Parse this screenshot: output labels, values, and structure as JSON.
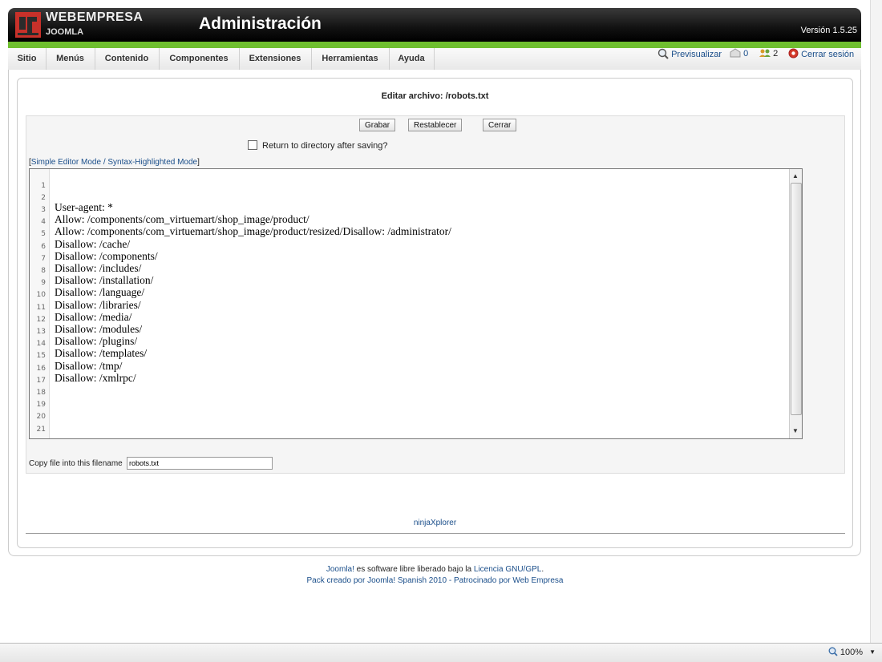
{
  "header": {
    "brand": "WEBEMPRESA",
    "brand_sub": "JOOMLA",
    "title": "Administración",
    "version": "Versión 1.5.25"
  },
  "menu": {
    "items": [
      "Sitio",
      "Menús",
      "Contenido",
      "Componentes",
      "Extensiones",
      "Herramientas",
      "Ayuda"
    ]
  },
  "status": {
    "preview": "Previsualizar",
    "messages_count": "0",
    "users_count": "2",
    "logout": "Cerrar sesión"
  },
  "editor": {
    "title": "Editar archivo: /robots.txt",
    "buttons": {
      "save": "Grabar",
      "reset": "Restablecer",
      "close": "Cerrar"
    },
    "return_label": "Return to directory after saving?",
    "mode_open": "[",
    "mode_simple": "Simple Editor Mode",
    "mode_sep": " / ",
    "mode_syntax": "Syntax-Highlighted Mode",
    "mode_close": "]",
    "line_numbers": [
      "1",
      "2",
      "3",
      "4",
      "5",
      "6",
      "7",
      "8",
      "9",
      "10",
      "11",
      "12",
      "13",
      "14",
      "15",
      "16",
      "17",
      "18",
      "19",
      "20",
      "21"
    ],
    "lines": [
      "",
      "",
      "User-agent: *",
      "Allow: /components/com_virtuemart/shop_image/product/",
      "Allow: /components/com_virtuemart/shop_image/product/resized/Disallow: /administrator/",
      "Disallow: /cache/",
      "Disallow: /components/",
      "Disallow: /includes/",
      "Disallow: /installation/",
      "Disallow: /language/",
      "Disallow: /libraries/",
      "Disallow: /media/",
      "Disallow: /modules/",
      "Disallow: /plugins/",
      "Disallow: /templates/",
      "Disallow: /tmp/",
      "Disallow: /xmlrpc/",
      "",
      "",
      "",
      ""
    ],
    "copy_label": "Copy file into this filename",
    "copy_value": "robots.txt",
    "footer_link": "ninjaXplorer"
  },
  "credits": {
    "joomla": "Joomla!",
    "text1": " es software libre liberado bajo la ",
    "license": "Licencia GNU/GPL",
    "dot": ".",
    "pack": "Pack creado por Joomla! Spanish 2010",
    "dash": " - ",
    "sponsor": "Patrocinado por Web Empresa"
  },
  "browser": {
    "zoom": "100%"
  },
  "colors": {
    "accent_green": "#6fbf2f",
    "link": "#1a4e8a",
    "header_dark": "#111111"
  }
}
